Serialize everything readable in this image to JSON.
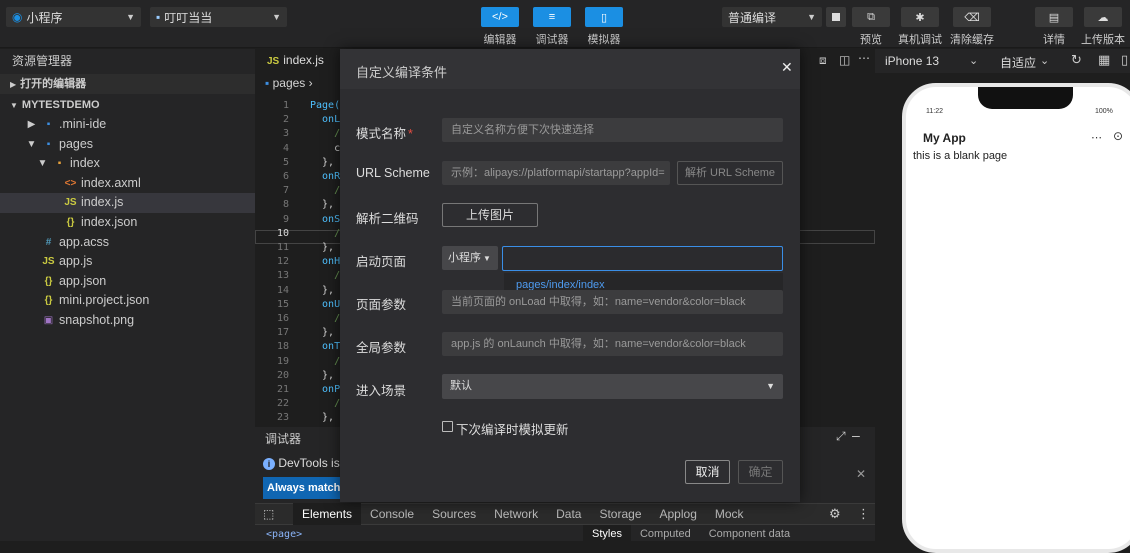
{
  "topbar": {
    "platform": "小程序",
    "app": "叮叮当当",
    "buttons": [
      {
        "label": "编辑器",
        "icon": "</>"
      },
      {
        "label": "调试器",
        "icon": "≡"
      },
      {
        "label": "模拟器",
        "icon": "▯"
      }
    ],
    "compile_mode": "普通编译",
    "actions": [
      {
        "label": "预览",
        "icon": "preview-icon"
      },
      {
        "label": "真机调试",
        "icon": "bug-icon"
      },
      {
        "label": "清除缓存",
        "icon": "broom-icon"
      },
      {
        "label": "详情",
        "icon": "doc-icon"
      },
      {
        "label": "上传版本",
        "icon": "cloud-upload-icon"
      }
    ]
  },
  "sidebar": {
    "title": "资源管理器",
    "open_editors": "打开的编辑器",
    "project": "MYTESTDEMO",
    "tree": [
      {
        "label": ".mini-ide",
        "icon": "▪",
        "indent": 1,
        "arrow": "▶",
        "color": "#3d8ee0"
      },
      {
        "label": "pages",
        "icon": "▪",
        "indent": 1,
        "arrow": "▼",
        "color": "#3d8ee0"
      },
      {
        "label": "index",
        "icon": "▪",
        "indent": 2,
        "arrow": "▼",
        "color": "#e6a23c"
      },
      {
        "label": "index.axml",
        "icon": "<>",
        "indent": 3,
        "arrow": "",
        "color": "#e37933"
      },
      {
        "label": "index.js",
        "icon": "JS",
        "indent": 3,
        "arrow": "",
        "color": "#cbcb41",
        "selected": true
      },
      {
        "label": "index.json",
        "icon": "{}",
        "indent": 3,
        "arrow": "",
        "color": "#cbcb41"
      },
      {
        "label": "app.acss",
        "icon": "#",
        "indent": 1,
        "arrow": "",
        "color": "#519aba"
      },
      {
        "label": "app.js",
        "icon": "JS",
        "indent": 1,
        "arrow": "",
        "color": "#cbcb41"
      },
      {
        "label": "app.json",
        "icon": "{}",
        "indent": 1,
        "arrow": "",
        "color": "#cbcb41"
      },
      {
        "label": "mini.project.json",
        "icon": "{}",
        "indent": 1,
        "arrow": "",
        "color": "#cbcb41"
      },
      {
        "label": "snapshot.png",
        "icon": "▣",
        "indent": 1,
        "arrow": "",
        "color": "#a074c4"
      }
    ]
  },
  "editor": {
    "tab": "index.js",
    "breadcrumb": "pages",
    "line_numbers": [
      "1",
      "2",
      "3",
      "4",
      "5",
      "6",
      "7",
      "8",
      "9",
      "10",
      "11",
      "12",
      "13",
      "14",
      "15",
      "16",
      "17",
      "18",
      "19",
      "20",
      "21",
      "22",
      "23"
    ],
    "code_lines": [
      "Page(",
      "  onL",
      "    /",
      "    c",
      "  },",
      "  onR",
      "    /",
      "  },",
      "  onS",
      "    /",
      "  },",
      "  onH",
      "    /",
      "  },",
      "  onU",
      "    /",
      "  },",
      "  onT",
      "    /",
      "  },",
      "  onP",
      "    /",
      "  },"
    ]
  },
  "devtools": {
    "title": "调试器",
    "info": "DevTools is n",
    "match_btn": "Always match C",
    "tabs": [
      "Elements",
      "Console",
      "Sources",
      "Network",
      "Data",
      "Storage",
      "Applog",
      "Mock"
    ],
    "active_tab": "Elements",
    "dom_preview": "<page>",
    "style_tabs": [
      "Styles",
      "Computed",
      "Component data"
    ]
  },
  "modal": {
    "title": "自定义编译条件",
    "fields": {
      "mode_name": {
        "label": "模式名称",
        "required": "*",
        "placeholder": "自定义名称方便下次快速选择"
      },
      "url_scheme": {
        "label": "URL Scheme",
        "placeholder": "示例：alipays://platformapi/startapp?appId=",
        "parse_btn": "解析 URL Scheme"
      },
      "qrcode": {
        "label": "解析二维码",
        "upload_btn": "上传图片"
      },
      "start_page": {
        "label": "启动页面",
        "type": "小程序",
        "value": "",
        "suggestion": "pages/index/index"
      },
      "page_params": {
        "label": "页面参数",
        "placeholder": "当前页面的 onLoad 中取得，如：name=vendor&color=black"
      },
      "global_params": {
        "label": "全局参数",
        "placeholder": "app.js 的 onLaunch 中取得，如：name=vendor&color=black"
      },
      "scene": {
        "label": "进入场景",
        "value": "默认"
      }
    },
    "checkbox": "下次编译时模拟更新",
    "cancel": "取消",
    "confirm": "确定"
  },
  "simulator": {
    "device": "iPhone 13",
    "fit": "自适应",
    "time": "11:22",
    "battery": "100%",
    "nav_title": "My App",
    "content": "this is a blank page"
  }
}
